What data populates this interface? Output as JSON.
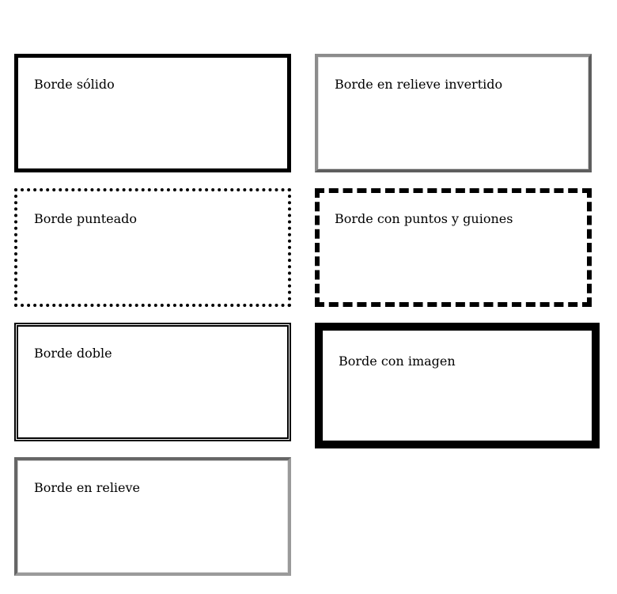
{
  "boxes": [
    {
      "label": "Borde sólido"
    },
    {
      "label": "Borde en relieve invertido"
    },
    {
      "label": "Borde punteado"
    },
    {
      "label": "Borde con puntos y guiones"
    },
    {
      "label": "Borde doble"
    },
    {
      "label": "Borde con imagen"
    },
    {
      "label": "Borde en relieve"
    }
  ],
  "colors": {
    "background": "#ffffff",
    "border": "#000000",
    "relief_gray": "#777777"
  }
}
